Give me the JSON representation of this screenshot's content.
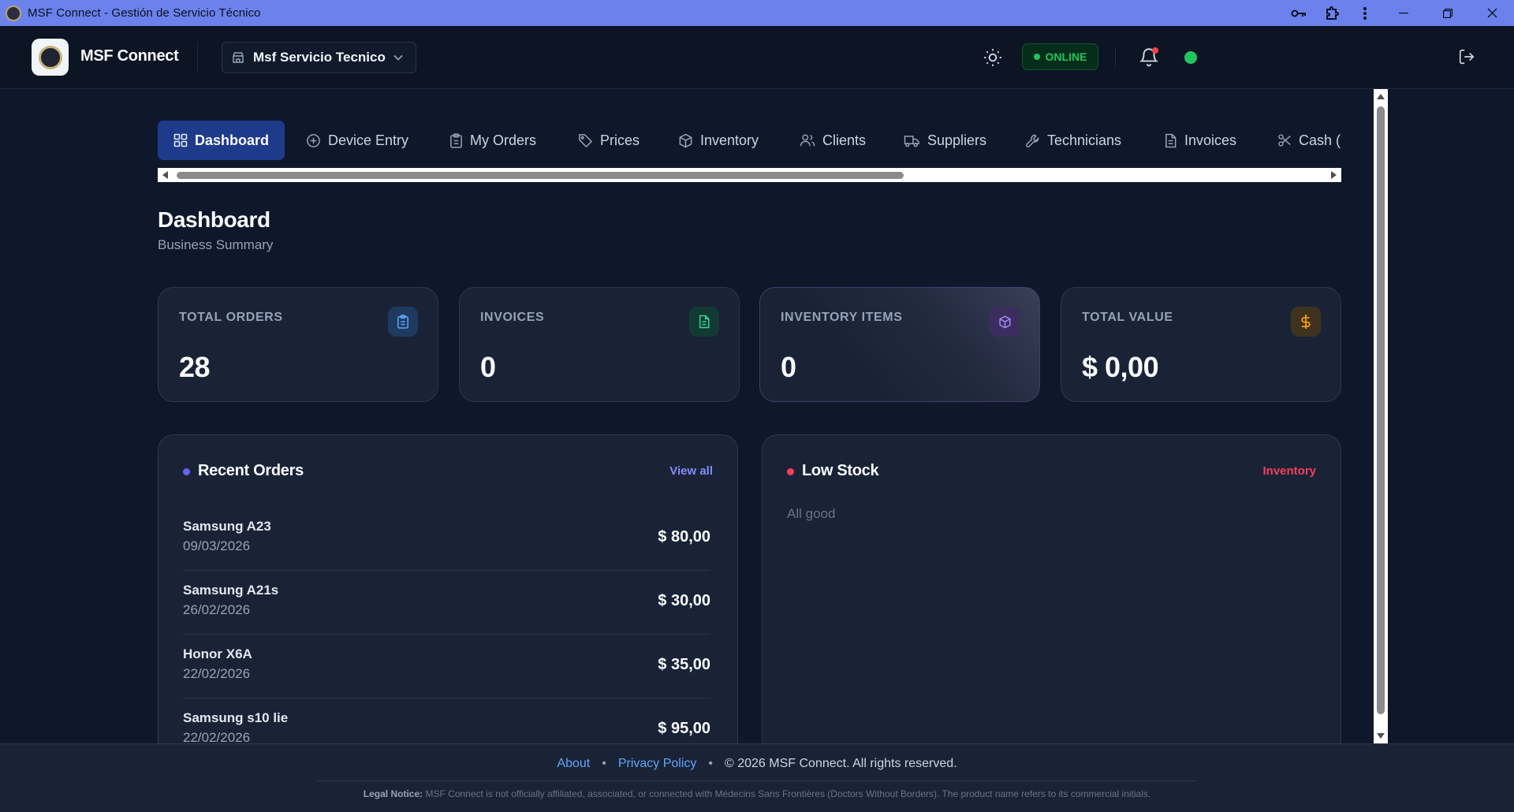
{
  "window": {
    "title": "MSF Connect - Gestión de Servicio Técnico"
  },
  "header": {
    "brand": "MSF Connect",
    "branch_selector": "Msf Servicio Tecnico",
    "status": "ONLINE"
  },
  "nav": {
    "items": [
      {
        "label": "Dashboard",
        "icon": "grid-icon",
        "active": true
      },
      {
        "label": "Device Entry",
        "icon": "plus-circle-icon"
      },
      {
        "label": "My Orders",
        "icon": "clipboard-icon"
      },
      {
        "label": "Prices",
        "icon": "tag-icon"
      },
      {
        "label": "Inventory",
        "icon": "box-icon"
      },
      {
        "label": "Clients",
        "icon": "users-icon"
      },
      {
        "label": "Suppliers",
        "icon": "truck-icon"
      },
      {
        "label": "Technicians",
        "icon": "wrench-icon"
      },
      {
        "label": "Invoices",
        "icon": "document-icon"
      },
      {
        "label": "Cash (",
        "icon": "scissors-icon"
      }
    ]
  },
  "page": {
    "title": "Dashboard",
    "subtitle": "Business Summary"
  },
  "stats": [
    {
      "label": "TOTAL ORDERS",
      "value": "28",
      "icon": "clipboard-icon",
      "color": "#60a5fa"
    },
    {
      "label": "INVOICES",
      "value": "0",
      "icon": "document-icon",
      "color": "#34d399"
    },
    {
      "label": "INVENTORY ITEMS",
      "value": "0",
      "icon": "box-icon",
      "color": "#a78bfa"
    },
    {
      "label": "TOTAL VALUE",
      "value": "$ 0,00",
      "icon": "dollar-icon",
      "color": "#f59e0b"
    }
  ],
  "recent_orders": {
    "title": "Recent Orders",
    "link": "View all",
    "rows": [
      {
        "name": "Samsung A23",
        "date": "09/03/2026",
        "amount": "$ 80,00"
      },
      {
        "name": "Samsung A21s",
        "date": "26/02/2026",
        "amount": "$ 30,00"
      },
      {
        "name": "Honor X6A",
        "date": "22/02/2026",
        "amount": "$ 35,00"
      },
      {
        "name": "Samsung s10 lie",
        "date": "22/02/2026",
        "amount": "$ 95,00"
      }
    ]
  },
  "low_stock": {
    "title": "Low Stock",
    "link": "Inventory",
    "empty": "All good"
  },
  "footer": {
    "about": "About",
    "privacy": "Privacy Policy",
    "copyright": "© 2026 MSF Connect. All rights reserved.",
    "legal_label": "Legal Notice:",
    "legal_text": "MSF Connect is not officially affiliated, associated, or connected with Médecins Sans Frontières (Doctors Without Borders). The product name refers to its commercial initials."
  },
  "colors": {
    "accent": "#1e3a8a",
    "online": "#22c55e",
    "link_blue": "#818cf8",
    "link_red": "#f43f5e",
    "dot_blue": "#6366f1",
    "dot_red": "#f43f5e"
  }
}
